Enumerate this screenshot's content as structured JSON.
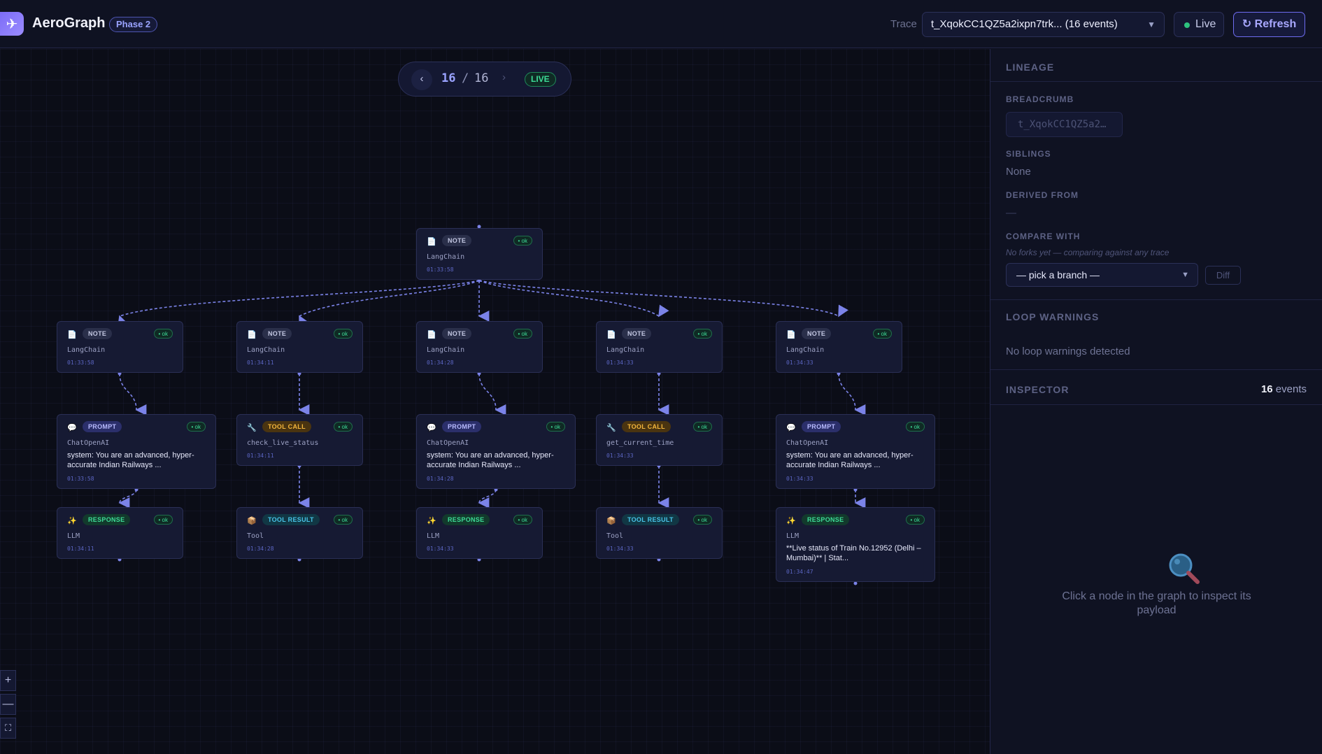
{
  "header": {
    "app_name": "AeroGraph",
    "phase": "Phase 2",
    "trace_label": "Trace",
    "trace_value": "t_XqokCC1QZ5a2ixpn7trk... (16 events)",
    "live_label": "Live",
    "refresh_label": "↻ Refresh"
  },
  "stepper": {
    "current": "16",
    "separator": "/",
    "total": "16",
    "live_label": "LIVE"
  },
  "nodes": [
    {
      "type": "NOTE",
      "status": "• ok",
      "source": "LangChain",
      "time": "01:33:58"
    },
    {
      "type": "NOTE",
      "status": "• ok",
      "source": "LangChain",
      "time": "01:33:58"
    },
    {
      "type": "NOTE",
      "status": "• ok",
      "source": "LangChain",
      "time": "01:34:11"
    },
    {
      "type": "NOTE",
      "status": "• ok",
      "source": "LangChain",
      "time": "01:34:28"
    },
    {
      "type": "NOTE",
      "status": "• ok",
      "source": "LangChain",
      "time": "01:34:33"
    },
    {
      "type": "NOTE",
      "status": "• ok",
      "source": "LangChain",
      "time": "01:34:33"
    },
    {
      "type": "PROMPT",
      "status": "• ok",
      "source": "ChatOpenAI",
      "message": "system: You are an advanced, hyper-accurate Indian Railways ...",
      "time": "01:33:58"
    },
    {
      "type": "TOOL CALL",
      "status": "• ok",
      "source": "check_live_status",
      "time": "01:34:11"
    },
    {
      "type": "PROMPT",
      "status": "• ok",
      "source": "ChatOpenAI",
      "message": "system: You are an advanced, hyper-accurate Indian Railways ...",
      "time": "01:34:28"
    },
    {
      "type": "TOOL CALL",
      "status": "• ok",
      "source": "get_current_time",
      "time": "01:34:33"
    },
    {
      "type": "PROMPT",
      "status": "• ok",
      "source": "ChatOpenAI",
      "message": "system: You are an advanced, hyper-accurate Indian Railways ...",
      "time": "01:34:33"
    },
    {
      "type": "RESPONSE",
      "status": "• ok",
      "source": "LLM",
      "time": "01:34:11"
    },
    {
      "type": "TOOL RESULT",
      "status": "• ok",
      "source": "Tool",
      "time": "01:34:28"
    },
    {
      "type": "RESPONSE",
      "status": "• ok",
      "source": "LLM",
      "time": "01:34:33"
    },
    {
      "type": "TOOL RESULT",
      "status": "• ok",
      "source": "Tool",
      "time": "01:34:33"
    },
    {
      "type": "RESPONSE",
      "status": "• ok",
      "source": "LLM",
      "message": "**Live status of Train No.12952 (Delhi – Mumbai)** | Stat...",
      "time": "01:34:47"
    }
  ],
  "zoom": {
    "in": "+",
    "out": "—",
    "fit": "⛶"
  },
  "panel": {
    "lineage_title": "LINEAGE",
    "breadcrumb_title": "BREADCRUMB",
    "breadcrumb_value": "t_XqokCC1QZ5a2…",
    "siblings_title": "SIBLINGS",
    "siblings_value": "None",
    "derived_title": "DERIVED FROM",
    "derived_value": "—",
    "compare_title": "COMPARE WITH",
    "compare_hint": "No forks yet — comparing against any trace",
    "branch_placeholder": "— pick a branch —",
    "diff_label": "Diff",
    "loop_title": "LOOP WARNINGS",
    "loop_value": "No loop warnings detected",
    "inspector_title": "INSPECTOR",
    "events_count": "16",
    "events_label": "events",
    "inspect_hint": "Click a node in the graph to inspect its payload"
  },
  "colors": {
    "accent": "#7c6cf6",
    "ok": "#3ddc97",
    "tool": "#f4b63c",
    "result": "#47c4e8",
    "edge": "#7b83e8"
  }
}
